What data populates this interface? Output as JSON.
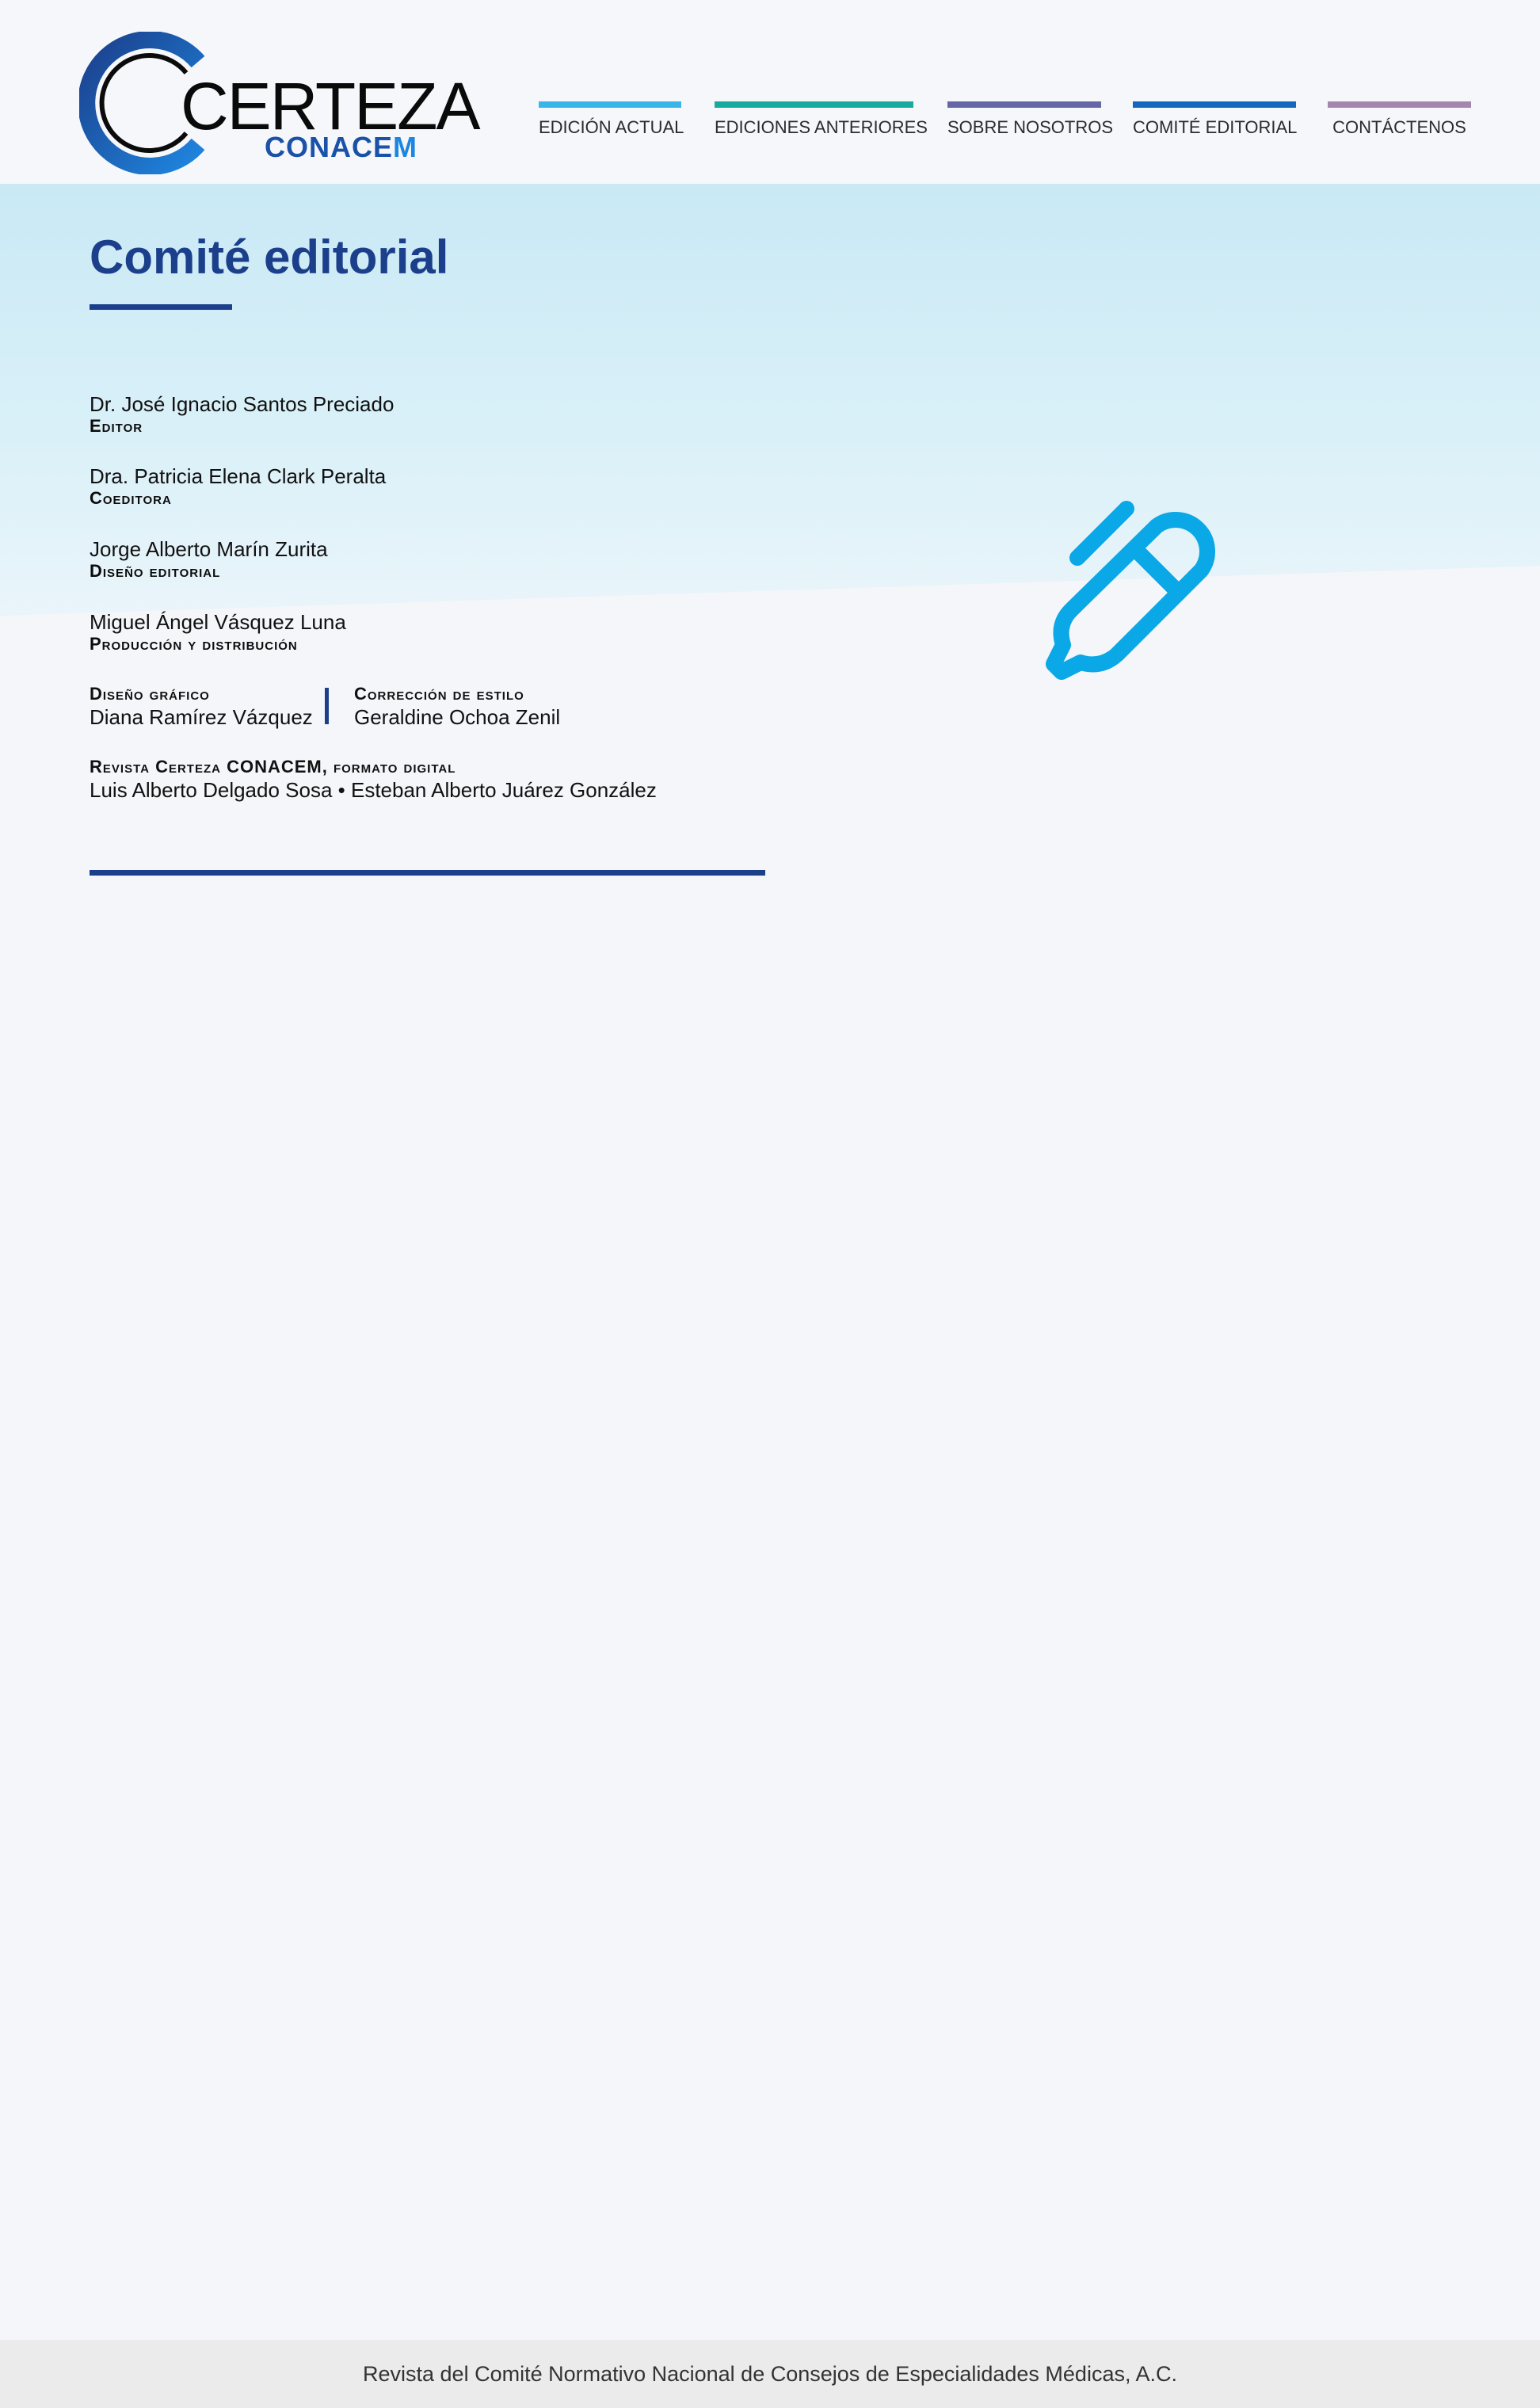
{
  "brand": {
    "logo_word": "CERTEZA",
    "logo_sub_main": "CONACE",
    "logo_sub_last": "M",
    "colors": {
      "navy": "#1b3f8b",
      "blue": "#1f86e0",
      "accent_pen": "#0aa8e6"
    }
  },
  "nav": {
    "items": [
      {
        "label": "EDICIÓN ACTUAL",
        "color": "#38b6ea"
      },
      {
        "label": "EDICIONES ANTERIORES",
        "color": "#17ab9f"
      },
      {
        "label": "SOBRE NOSOTROS",
        "color": "#6466a8"
      },
      {
        "label": "COMITÉ EDITORIAL",
        "color": "#1566c0"
      },
      {
        "label": "CONTÁCTENOS",
        "color": "#a587ad"
      }
    ]
  },
  "page": {
    "title": "Comité editorial",
    "entries": [
      {
        "name": "Dr. José Ignacio Santos Preciado",
        "role": "Editor"
      },
      {
        "name": "Dra. Patricia Elena Clark Peralta",
        "role": "Coeditora"
      },
      {
        "name": "Jorge Alberto Marín Zurita",
        "role": "Diseño editorial"
      },
      {
        "name": "Miguel Ángel Vásquez Luna",
        "role": "Producción y distribución"
      }
    ],
    "graphic_design": {
      "role": "Diseño gráfico",
      "name": "Diana Ramírez Vázquez"
    },
    "copy_editing": {
      "role": "Corrección de estilo",
      "name": "Geraldine Ochoa Zenil"
    },
    "digital": {
      "role": "Revista Certeza CONACEM, formato digital",
      "names": "Luis Alberto Delgado Sosa • Esteban Alberto Juárez González"
    },
    "decor_icon": "pen-icon"
  },
  "footer": {
    "text": "Revista del Comité Normativo Nacional de Consejos de Especialidades Médicas, A.C."
  }
}
